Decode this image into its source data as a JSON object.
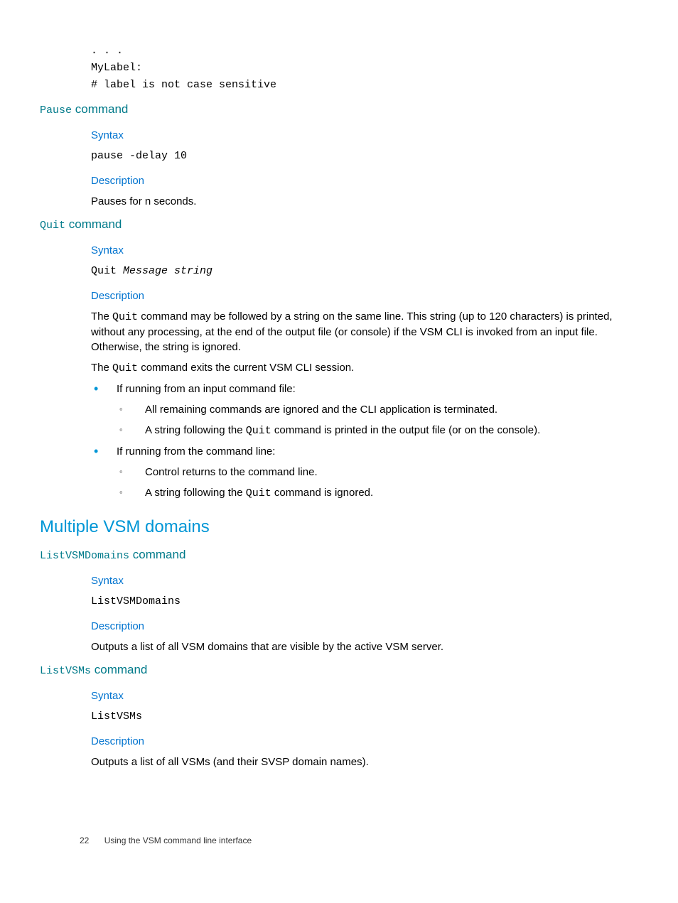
{
  "codeTop": {
    "l1": ". . .",
    "l2": "MyLabel:",
    "l3": "# label is not case sensitive"
  },
  "pause": {
    "heading_cmd": "Pause",
    "heading_rest": " command",
    "syntax_label": "Syntax",
    "syntax_code": "pause -delay 10",
    "desc_label": "Description",
    "desc_text": "Pauses for n seconds."
  },
  "quit": {
    "heading_cmd": "Quit",
    "heading_rest": " command",
    "syntax_label": "Syntax",
    "syntax_code_a": "Quit",
    "syntax_code_b": " Message string",
    "desc_label": "Description",
    "p1a": "The ",
    "p1b": "Quit",
    "p1c": " command may be followed by a string on the same line. This string (up to 120 characters) is printed, without any processing, at the end of the output file (or console) if the VSM CLI is invoked from an input file. Otherwise, the string is ignored.",
    "p2a": "The ",
    "p2b": "Quit",
    "p2c": " command exits the current VSM CLI session.",
    "b1": "If running from an input command file:",
    "b1s1": "All remaining commands are ignored and the CLI application is terminated.",
    "b1s2a": "A string following the ",
    "b1s2b": "Quit",
    "b1s2c": " command is printed in the output file (or on the console).",
    "b2": "If running from the command line:",
    "b2s1": "Control returns to the command line.",
    "b2s2a": "A string following the ",
    "b2s2b": "Quit",
    "b2s2c": " command is ignored."
  },
  "domains": {
    "section_title": "Multiple VSM domains"
  },
  "listDomains": {
    "heading_cmd": "ListVSMDomains",
    "heading_rest": " command",
    "syntax_label": "Syntax",
    "syntax_code": "ListVSMDomains",
    "desc_label": "Description",
    "desc_text": "Outputs a list of all VSM domains that are visible by the active VSM server."
  },
  "listVSMs": {
    "heading_cmd": "ListVSMs",
    "heading_rest": " command",
    "syntax_label": "Syntax",
    "syntax_code": "ListVSMs",
    "desc_label": "Description",
    "desc_text": "Outputs a list of all VSMs (and their SVSP domain names)."
  },
  "footer": {
    "page": "22",
    "title": "Using the VSM command line interface"
  }
}
